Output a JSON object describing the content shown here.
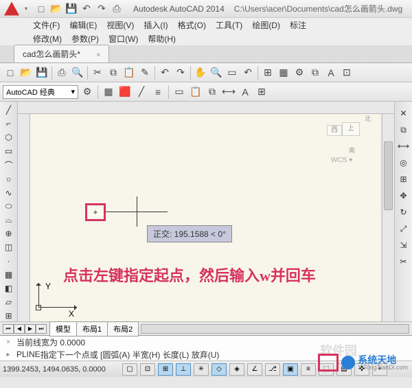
{
  "titlebar": {
    "app": "Autodesk AutoCAD 2014",
    "path": "C:\\Users\\acer\\Documents\\cad怎么画箭头.dwg"
  },
  "menu1": {
    "file": "文件(F)",
    "edit": "编辑(E)",
    "view": "视图(V)",
    "insert": "插入(I)",
    "format": "格式(O)",
    "tools": "工具(T)",
    "draw": "绘图(D)",
    "dim": "标注"
  },
  "menu2": {
    "modify": "修改(M)",
    "params": "参数(P)",
    "window": "窗口(W)",
    "help": "帮助(H)"
  },
  "tab": {
    "name": "cad怎么画箭头*",
    "close": "×"
  },
  "style": {
    "combo": "AutoCAD 经典",
    "arrow": "▾"
  },
  "viewcube": {
    "top": "上",
    "left": "西",
    "north": "北",
    "south": "南",
    "wcs": "WCS ▾"
  },
  "tooltip": {
    "text": "正交: 195.1588 < 0°"
  },
  "instruction": {
    "text": "点击左键指定起点，然后输入w并回车"
  },
  "ucs": {
    "x": "X",
    "y": "Y"
  },
  "layout": {
    "model": "模型",
    "l1": "布局1",
    "l2": "布局2"
  },
  "cmd": {
    "line1": "当前线宽为  0.0000",
    "prefix": "PLINE ",
    "line2": "指定下一个点或 [",
    "arc": "圆弧(A)",
    "hw": "半宽(H)",
    "len": "长度(L)",
    "undo": "放弃(U)"
  },
  "status": {
    "coords": "1399.2453, 1494.0635, 0.0000"
  },
  "watermark": {
    "cn": "系统天地",
    "en": "XiTongTianDi.com"
  },
  "faded": "软件园",
  "nav": {
    "first": "⏮",
    "prev": "◀",
    "next": "▶",
    "last": "⏭"
  },
  "icons": {
    "new": "□",
    "open": "📂",
    "save": "💾",
    "undo": "↶",
    "redo": "↷",
    "print": "⎙",
    "cut": "✂",
    "copy": "⧉",
    "paste": "📋",
    "match": "✎",
    "pan": "✋",
    "zoom": "🔍",
    "line": "╱",
    "pline": "⌐",
    "circle": "○",
    "arc": "⌒",
    "rect": "▭",
    "hatch": "▦",
    "text": "A",
    "dim": "⟷",
    "point": "·",
    "ellipse": "⬭",
    "spline": "∿",
    "grid": "⊞",
    "snap": "⊡",
    "ortho": "⊥",
    "polar": "✳",
    "osnap": "◇",
    "dyn": "▣",
    "lwt": "≡",
    "plus": "+",
    "gear": "⚙",
    "arrow": "▾"
  }
}
